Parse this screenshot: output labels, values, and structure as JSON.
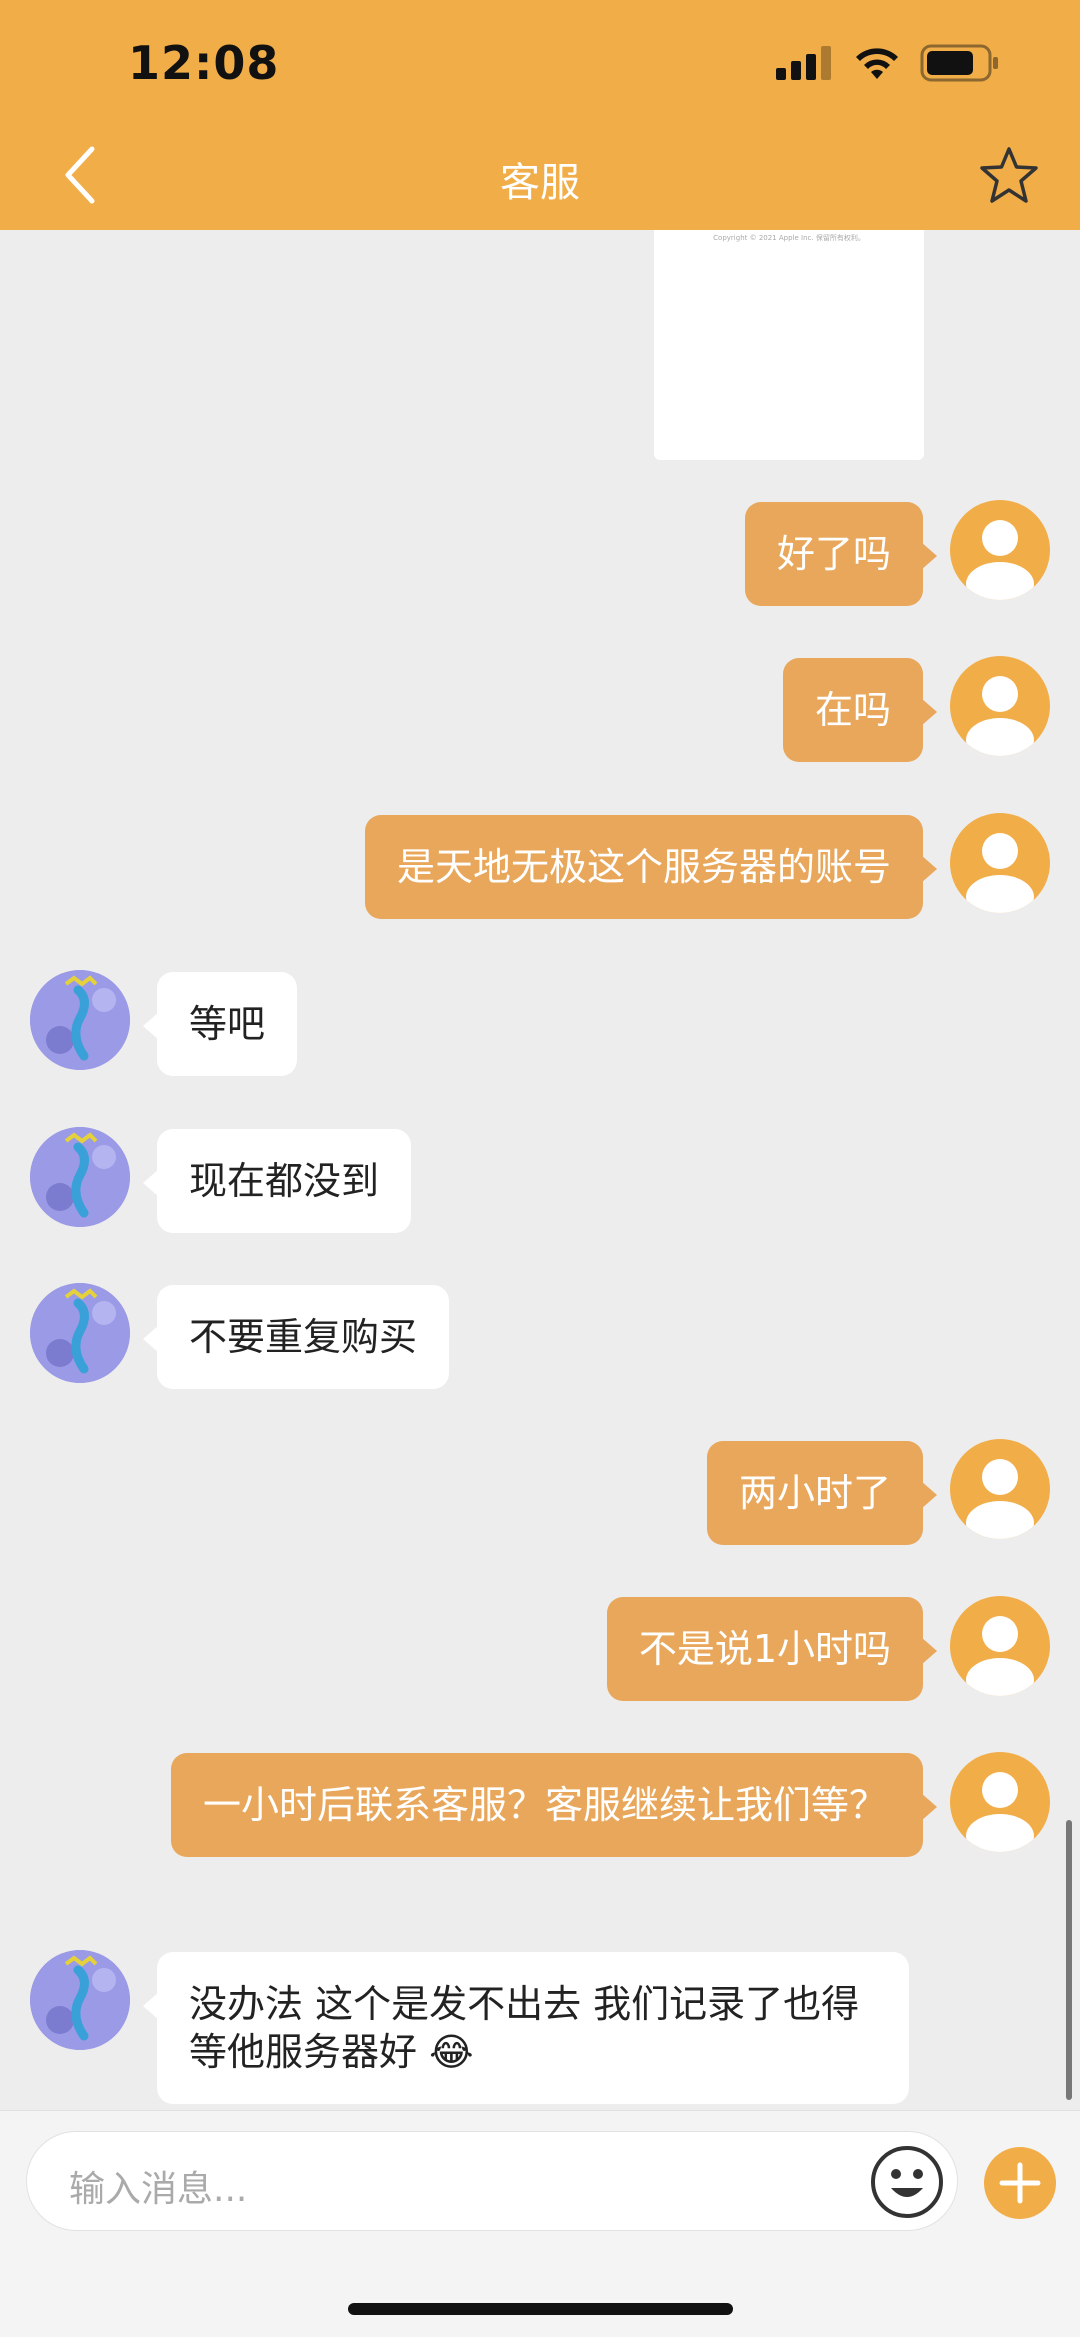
{
  "status_bar": {
    "time": "12:08"
  },
  "header": {
    "title": "客服",
    "back_icon": "chevron-left-icon",
    "favorite_icon": "star-outline-icon"
  },
  "image_message": {
    "caption": "Copyright © 2021 Apple Inc. 保留所有权利。"
  },
  "messages": [
    {
      "side": "out",
      "text": "好了吗"
    },
    {
      "side": "out",
      "text": "在吗"
    },
    {
      "side": "out",
      "text": "是天地无极这个服务器的账号"
    },
    {
      "side": "in",
      "text": "等吧"
    },
    {
      "side": "in",
      "text": "现在都没到"
    },
    {
      "side": "in",
      "text": "不要重复购买"
    },
    {
      "side": "out",
      "text": "两小时了"
    },
    {
      "side": "out",
      "text": "不是说1小时吗"
    },
    {
      "side": "out",
      "text": "一小时后联系客服？客服继续让我们等？"
    },
    {
      "side": "in",
      "text": "没办法 这个是发不出去 我们记录了也得等他服务器好 😂"
    }
  ],
  "composer": {
    "placeholder": "输入消息...",
    "emoji_icon": "emoji-icon",
    "add_icon": "plus-icon"
  },
  "colors": {
    "brand": "#f1ad47",
    "outgoing_bubble": "#e8a75b",
    "incoming_bubble": "#ffffff",
    "background": "#ededed"
  }
}
